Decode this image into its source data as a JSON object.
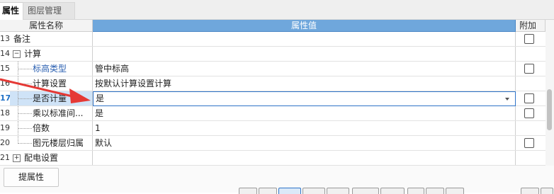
{
  "tabs": [
    {
      "label": "属性",
      "active": true
    },
    {
      "label": "图层管理",
      "active": false
    }
  ],
  "headers": {
    "name": "属性名称",
    "value": "属性值",
    "add": "附加"
  },
  "rows": [
    {
      "num": "13",
      "name": "备注",
      "value": "",
      "checkbox": true
    },
    {
      "num": "14",
      "name": "计算",
      "value": "",
      "checkbox": false,
      "expander": "−"
    },
    {
      "num": "15",
      "name": "标高类型",
      "value": "管中标高",
      "checkbox": true
    },
    {
      "num": "16",
      "name": "计算设置",
      "value": "按默认计算设置计算",
      "checkbox": false
    },
    {
      "num": "17",
      "name": "是否计量",
      "value": "是",
      "checkbox": true,
      "selected": true
    },
    {
      "num": "18",
      "name": "乘以标准间...",
      "value": "是",
      "checkbox": true
    },
    {
      "num": "19",
      "name": "倍数",
      "value": "1",
      "checkbox": false
    },
    {
      "num": "20",
      "name": "图元楼层归属",
      "value": "默认",
      "checkbox": true
    },
    {
      "num": "21",
      "name": "配电设置",
      "value": "",
      "checkbox": false,
      "expander": "+"
    }
  ],
  "bottom": {
    "button_label": "提属性"
  },
  "colors": {
    "header_value_bg": "#6fa7dc",
    "annotation_arrow": "#e53935",
    "selected_border": "#2f74c8"
  }
}
